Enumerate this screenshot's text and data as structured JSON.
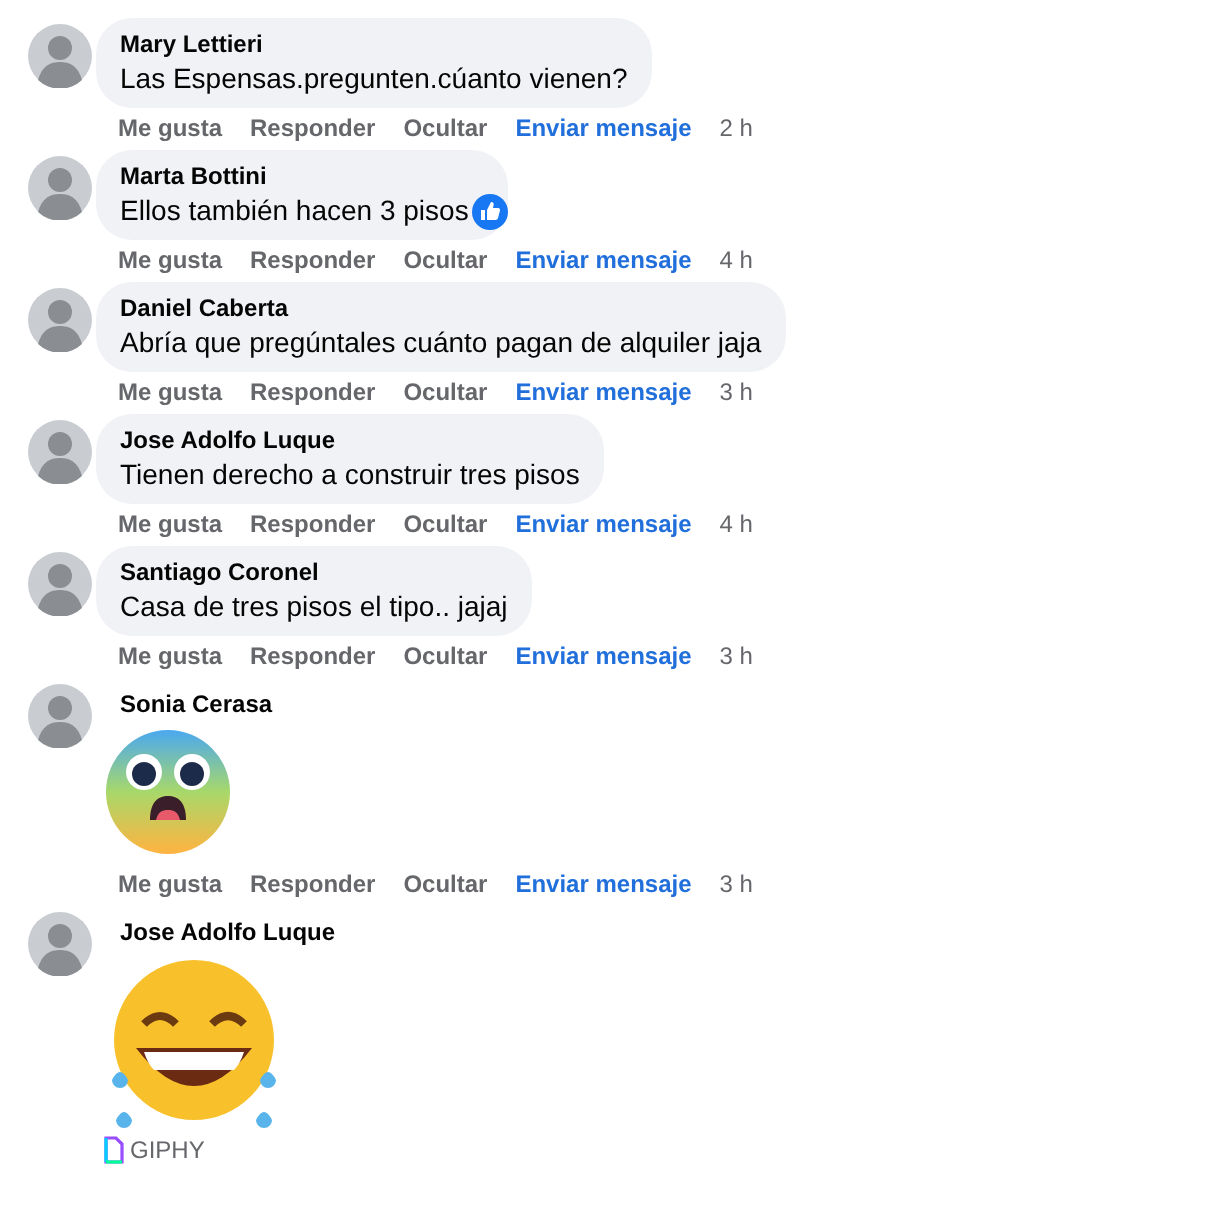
{
  "comments": [
    {
      "kind": "text",
      "author": "Mary Lettieri",
      "text": "Las Espensas.pregunten.cúanto vienen?",
      "like_badge": false,
      "actions": [
        "Me gusta",
        "Responder",
        "Ocultar",
        "Enviar mensaje"
      ],
      "time": "2 h"
    },
    {
      "kind": "text",
      "author": "Marta Bottini",
      "text": "Ellos también hacen 3 pisos",
      "like_badge": true,
      "actions": [
        "Me gusta",
        "Responder",
        "Ocultar",
        "Enviar mensaje"
      ],
      "time": "4 h"
    },
    {
      "kind": "text",
      "author": "Daniel Caberta",
      "text": "Abría que pregúntales cuánto pagan de alquiler jaja",
      "like_badge": false,
      "actions": [
        "Me gusta",
        "Responder",
        "Ocultar",
        "Enviar mensaje"
      ],
      "time": "3 h"
    },
    {
      "kind": "text",
      "author": "Jose Adolfo Luque",
      "text": "Tienen derecho a construir tres pisos",
      "like_badge": false,
      "actions": [
        "Me gusta",
        "Responder",
        "Ocultar",
        "Enviar mensaje"
      ],
      "time": "4 h"
    },
    {
      "kind": "text",
      "author": "Santiago Coronel",
      "text": "Casa de tres pisos el tipo.. jajaj",
      "like_badge": false,
      "actions": [
        "Me gusta",
        "Responder",
        "Ocultar",
        "Enviar mensaje"
      ],
      "time": "3 h"
    },
    {
      "kind": "sticker",
      "author": "Sonia Cerasa",
      "actions": [
        "Me gusta",
        "Responder",
        "Ocultar",
        "Enviar mensaje"
      ],
      "time": "3 h"
    },
    {
      "kind": "gif",
      "author": "Jose Adolfo Luque",
      "source": "GIPHY"
    }
  ]
}
